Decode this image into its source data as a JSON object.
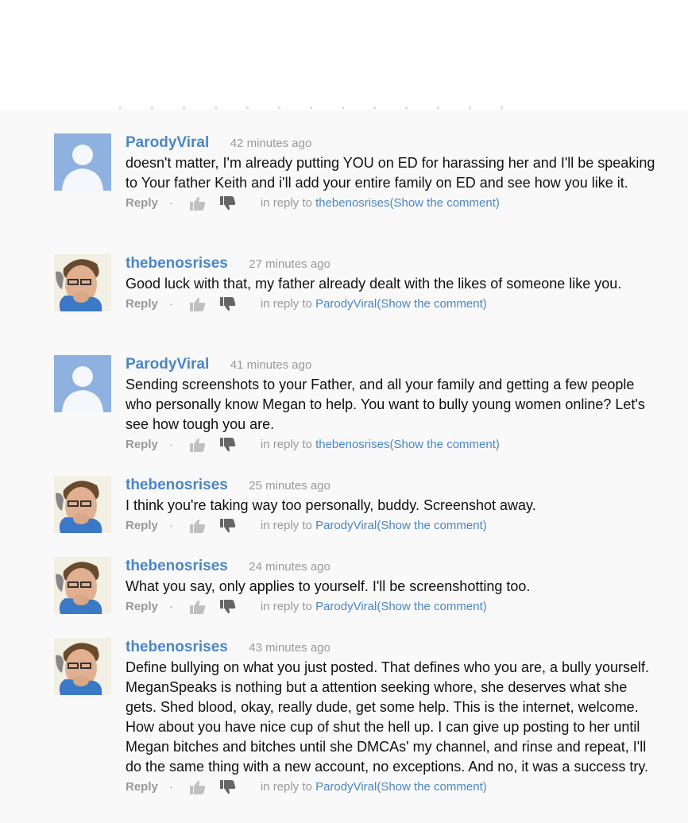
{
  "comments": [
    {
      "author": "ParodyViral",
      "time": "42 minutes ago",
      "avatar": "default",
      "text": "doesn't matter, I'm already putting YOU on ED for harassing her and I'll be speaking to Your father Keith and i'll add your entire family on ED and see how you like it.",
      "reply_label": "Reply",
      "separator": "·",
      "in_reply_prefix": "in reply to",
      "reply_target": "thebenosrises",
      "show_comment": "(Show the comment)"
    },
    {
      "author": "thebenosrises",
      "time": "27 minutes ago",
      "avatar": "photo",
      "text": "Good luck with that, my father already dealt with the likes of someone like you.",
      "reply_label": "Reply",
      "separator": "·",
      "in_reply_prefix": "in reply to",
      "reply_target": "ParodyViral",
      "show_comment": "(Show the comment)"
    },
    {
      "author": "ParodyViral",
      "time": "41 minutes ago",
      "avatar": "default",
      "text": "Sending screenshots to your Father, and all your family and getting a few people who personally know Megan to help. You want to bully young women online? Let's see how tough you are.",
      "reply_label": "Reply",
      "separator": "·",
      "in_reply_prefix": "in reply to",
      "reply_target": "thebenosrises",
      "show_comment": "(Show the comment)"
    },
    {
      "author": "thebenosrises",
      "time": "25 minutes ago",
      "avatar": "photo",
      "text": "I think you're taking way too personally, buddy. Screenshot away.",
      "reply_label": "Reply",
      "separator": "·",
      "in_reply_prefix": "in reply to",
      "reply_target": "ParodyViral",
      "show_comment": "(Show the comment)"
    },
    {
      "author": "thebenosrises",
      "time": "24 minutes ago",
      "avatar": "photo",
      "text": "What you say, only applies to yourself. I'll be screenshotting too.",
      "reply_label": "Reply",
      "separator": "·",
      "in_reply_prefix": "in reply to",
      "reply_target": "ParodyViral",
      "show_comment": "(Show the comment)"
    },
    {
      "author": "thebenosrises",
      "time": "43 minutes ago",
      "avatar": "photo",
      "text": "Define bullying on what you just posted. That defines who you are, a bully yourself. MeganSpeaks is nothing but a attention seeking whore, she deserves what she gets. Shed blood, okay, really dude, get some help. This is the internet, welcome. How about you have nice cup of shut the hell up. I can give up posting to her until Megan bitches and bitches until she DMCAs' my channel, and rinse and repeat, I'll do the same thing with a new account, no exceptions. And no, it was a success try.",
      "reply_label": "Reply",
      "separator": "·",
      "in_reply_prefix": "in reply to",
      "reply_target": "ParodyViral",
      "show_comment": "(Show the comment)"
    }
  ],
  "icons": {
    "like": "thumbs-up-icon",
    "dislike": "thumbs-down-icon",
    "avatar_default": "default-avatar-silhouette",
    "avatar_photo": "user-photo"
  },
  "colors": {
    "link": "#4a86c5",
    "muted": "#999999",
    "text": "#111111",
    "panel_bg": "#f9f9f9",
    "avatar_default": "#8eb1df"
  }
}
